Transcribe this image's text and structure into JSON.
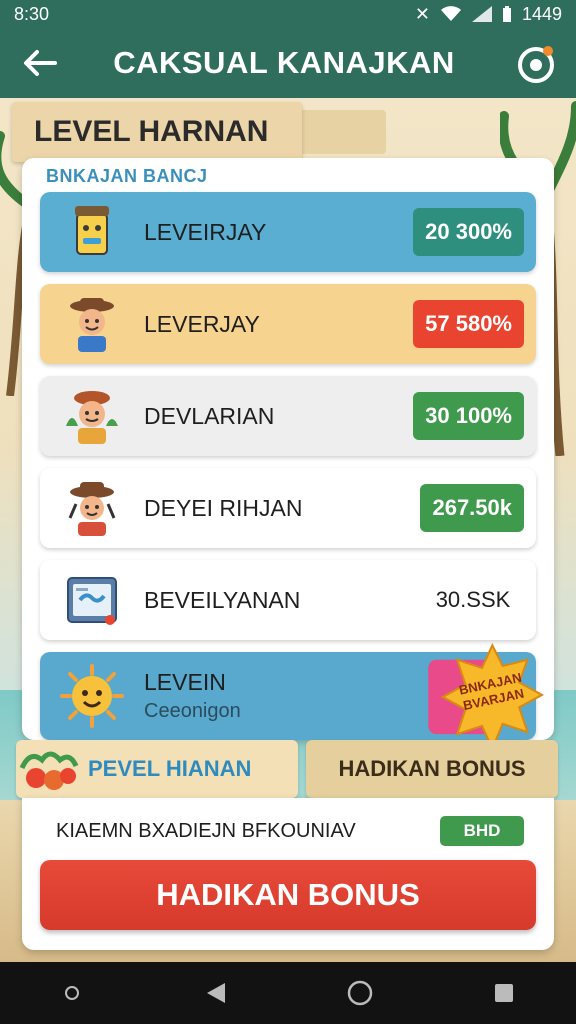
{
  "status_bar": {
    "time": "8:30",
    "battery_text": "1449"
  },
  "app_bar": {
    "title": "CAKSUAL KANAJKAN"
  },
  "banner": {
    "title": "LEVEL HARNAN"
  },
  "card": {
    "subtitle": "BNKAJAN BANCJ",
    "rows": [
      {
        "label": "LEVEIRJAY",
        "value": "20 300%",
        "color": "#2f8f7e",
        "bg": "#5aaed2"
      },
      {
        "label": "LEVERJAY",
        "value": "57 580%",
        "color": "#e8442f",
        "bg": "#f6d38e"
      },
      {
        "label": "DEVLARIAN",
        "value": "30 100%",
        "color": "#3f9a4e",
        "bg": "#eeeeee"
      },
      {
        "label": "DEYEI RIHJAN",
        "value": "267.50k",
        "color": "#3f9a4e",
        "bg": "#ffffff"
      },
      {
        "label": "BEVEILYANAN",
        "value": "30.SSK",
        "bg": "#ffffff"
      }
    ],
    "row6": {
      "label": "LEVEIN",
      "sub": "Ceeonigon",
      "bg": "#58a9cd",
      "burst_text": "BNKAJAN BVARJAN"
    }
  },
  "tabs": {
    "left_label": "PEVEL HIANAN",
    "right_label": "HADIKAN BONUS"
  },
  "bottom": {
    "info_text": "KIAEMN BXADIEJN BFKOUNIAV",
    "info_badge": "BHD",
    "bonus_button": "HADIKAN BONUS"
  },
  "icons": {
    "back": "arrow-left-icon",
    "settings": "gear-icon",
    "nav": [
      "circle-dot-icon",
      "back-triangle-icon",
      "home-circle-icon",
      "recents-square-icon"
    ]
  }
}
